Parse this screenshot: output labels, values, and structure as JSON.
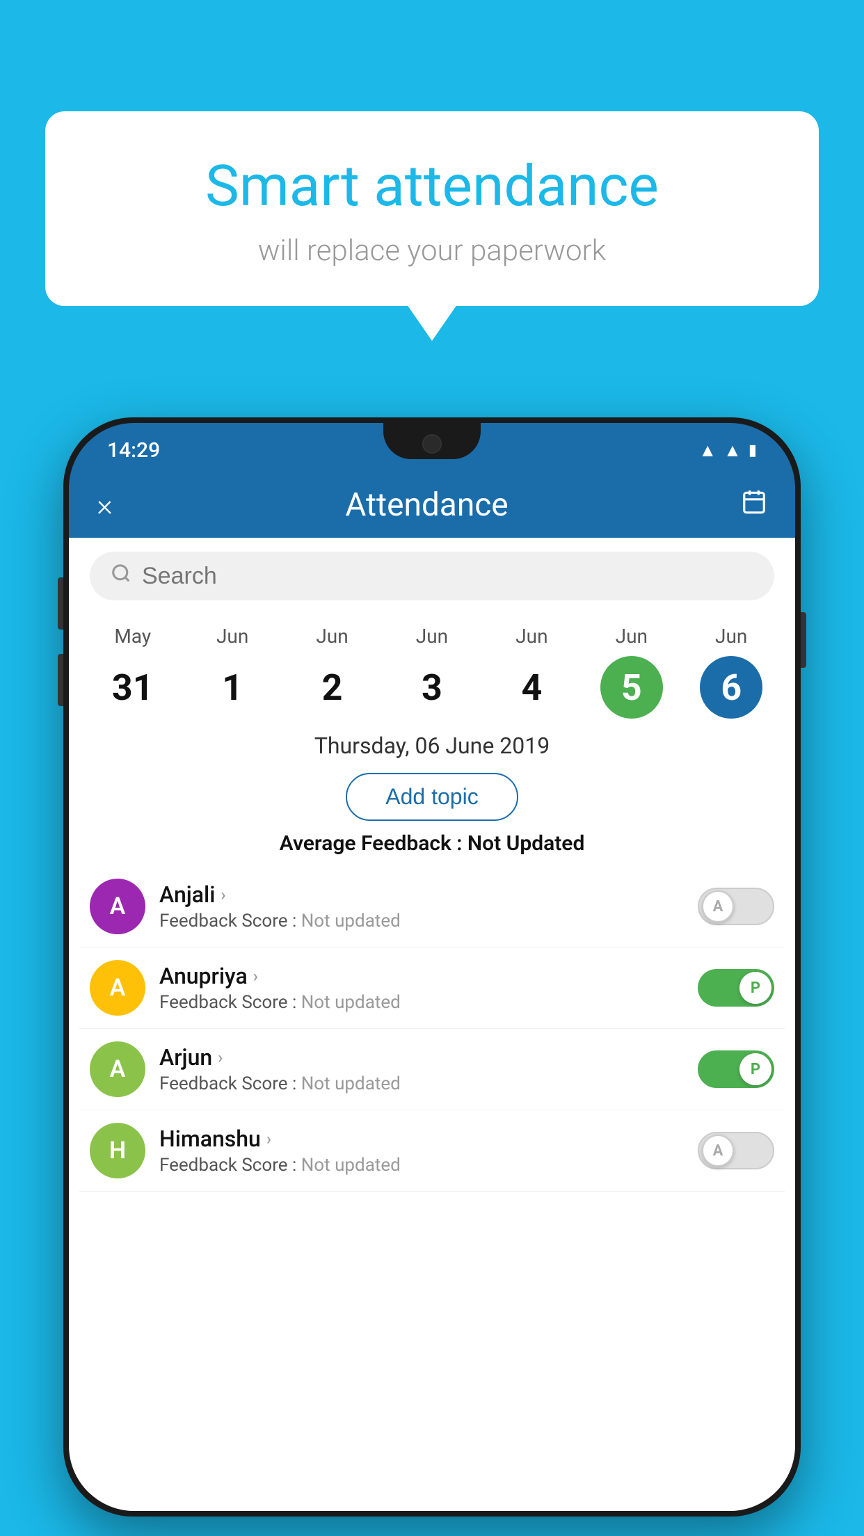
{
  "background_color": "#1BB8E8",
  "speech_bubble": {
    "title": "Smart attendance",
    "subtitle": "will replace your paperwork"
  },
  "status_bar": {
    "time": "14:29",
    "icons": [
      "wifi",
      "signal",
      "battery"
    ]
  },
  "app_bar": {
    "title": "Attendance",
    "close_label": "×",
    "calendar_label": "📅"
  },
  "search": {
    "placeholder": "Search"
  },
  "calendar": {
    "days": [
      {
        "month": "May",
        "date": "31",
        "state": "normal"
      },
      {
        "month": "Jun",
        "date": "1",
        "state": "normal"
      },
      {
        "month": "Jun",
        "date": "2",
        "state": "normal"
      },
      {
        "month": "Jun",
        "date": "3",
        "state": "normal"
      },
      {
        "month": "Jun",
        "date": "4",
        "state": "normal"
      },
      {
        "month": "Jun",
        "date": "5",
        "state": "today"
      },
      {
        "month": "Jun",
        "date": "6",
        "state": "selected"
      }
    ],
    "selected_date": "Thursday, 06 June 2019"
  },
  "add_topic_label": "Add topic",
  "avg_feedback_label": "Average Feedback :",
  "avg_feedback_value": "Not Updated",
  "students": [
    {
      "name": "Anjali",
      "avatar_letter": "A",
      "avatar_color": "#9C27B0",
      "feedback": "Not updated",
      "toggle_state": "off",
      "toggle_label": "A"
    },
    {
      "name": "Anupriya",
      "avatar_letter": "A",
      "avatar_color": "#FFC107",
      "feedback": "Not updated",
      "toggle_state": "on",
      "toggle_label": "P"
    },
    {
      "name": "Arjun",
      "avatar_letter": "A",
      "avatar_color": "#8BC34A",
      "feedback": "Not updated",
      "toggle_state": "on",
      "toggle_label": "P"
    },
    {
      "name": "Himanshu",
      "avatar_letter": "H",
      "avatar_color": "#8BC34A",
      "feedback": "Not updated",
      "toggle_state": "off",
      "toggle_label": "A"
    }
  ],
  "feedback_score_label": "Feedback Score :"
}
